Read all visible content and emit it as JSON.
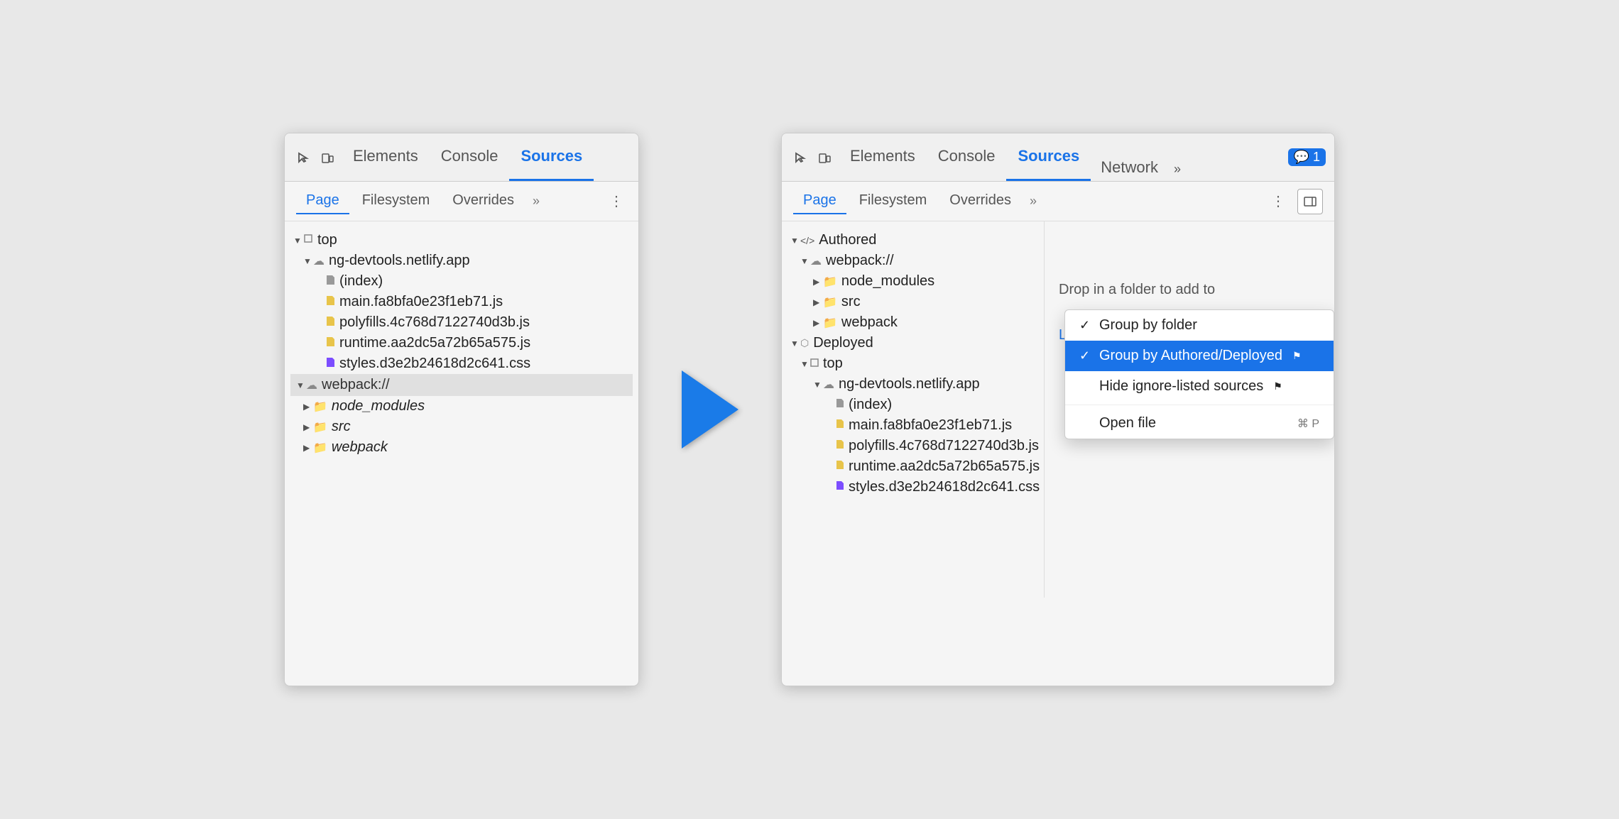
{
  "left_panel": {
    "toolbar": {
      "tabs": [
        "Elements",
        "Console",
        "Sources"
      ],
      "active_tab": "Sources"
    },
    "sub_tabs": {
      "items": [
        "Page",
        "Filesystem",
        "Overrides"
      ],
      "active": "Page"
    },
    "tree": [
      {
        "id": "top",
        "label": "top",
        "indent": 0,
        "type": "arrow_open",
        "icon": "square"
      },
      {
        "id": "ng-devtools",
        "label": "ng-devtools.netlify.app",
        "indent": 1,
        "type": "arrow_open",
        "icon": "cloud"
      },
      {
        "id": "index",
        "label": "(index)",
        "indent": 2,
        "type": "none",
        "icon": "html"
      },
      {
        "id": "main",
        "label": "main.fa8bfa0e23f1eb71.js",
        "indent": 2,
        "type": "none",
        "icon": "js"
      },
      {
        "id": "polyfills",
        "label": "polyfills.4c768d7122740d3b.js",
        "indent": 2,
        "type": "none",
        "icon": "js"
      },
      {
        "id": "runtime",
        "label": "runtime.aa2dc5a72b65a575.js",
        "indent": 2,
        "type": "none",
        "icon": "js"
      },
      {
        "id": "styles",
        "label": "styles.d3e2b24618d2c641.css",
        "indent": 2,
        "type": "none",
        "icon": "css"
      },
      {
        "id": "webpack",
        "label": "webpack://",
        "indent": 1,
        "type": "section",
        "icon": "cloud"
      },
      {
        "id": "node_modules",
        "label": "node_modules",
        "indent": 2,
        "type": "arrow_closed",
        "icon": "folder",
        "italic": true
      },
      {
        "id": "src",
        "label": "src",
        "indent": 2,
        "type": "arrow_closed",
        "icon": "folder",
        "italic": true
      },
      {
        "id": "webpack2",
        "label": "webpack",
        "indent": 2,
        "type": "arrow_closed",
        "icon": "folder",
        "italic": true
      }
    ]
  },
  "right_panel": {
    "toolbar": {
      "tabs": [
        "Elements",
        "Console",
        "Sources",
        "Network"
      ],
      "active_tab": "Sources",
      "more": ">>",
      "badge": "1"
    },
    "sub_tabs": {
      "items": [
        "Page",
        "Filesystem",
        "Overrides"
      ],
      "active": "Page"
    },
    "tree": [
      {
        "id": "authored",
        "label": "Authored",
        "indent": 0,
        "type": "arrow_open",
        "icon": "code"
      },
      {
        "id": "webpack-authored",
        "label": "webpack://",
        "indent": 1,
        "type": "arrow_open",
        "icon": "cloud"
      },
      {
        "id": "node_modules2",
        "label": "node_modules",
        "indent": 2,
        "type": "arrow_closed",
        "icon": "folder"
      },
      {
        "id": "src2",
        "label": "src",
        "indent": 2,
        "type": "arrow_closed",
        "icon": "folder"
      },
      {
        "id": "webpack3",
        "label": "webpack",
        "indent": 2,
        "type": "arrow_closed",
        "icon": "folder"
      },
      {
        "id": "deployed",
        "label": "Deployed",
        "indent": 0,
        "type": "arrow_open",
        "icon": "cube"
      },
      {
        "id": "top2",
        "label": "top",
        "indent": 1,
        "type": "arrow_open",
        "icon": "square"
      },
      {
        "id": "ng-devtools2",
        "label": "ng-devtools.netlify.app",
        "indent": 2,
        "type": "arrow_open",
        "icon": "cloud"
      },
      {
        "id": "index2",
        "label": "(index)",
        "indent": 3,
        "type": "none",
        "icon": "html"
      },
      {
        "id": "main2",
        "label": "main.fa8bfa0e23f1eb71.js",
        "indent": 3,
        "type": "none",
        "icon": "js"
      },
      {
        "id": "polyfills2",
        "label": "polyfills.4c768d7122740d3b.js",
        "indent": 3,
        "type": "none",
        "icon": "js"
      },
      {
        "id": "runtime2",
        "label": "runtime.aa2dc5a72b65a575.js",
        "indent": 3,
        "type": "none",
        "icon": "js"
      },
      {
        "id": "styles2",
        "label": "styles.d3e2b24618d2c641.css",
        "indent": 3,
        "type": "none",
        "icon": "css"
      }
    ],
    "filesystem": {
      "drop_text": "Drop in a folder to add to",
      "learn_more_text": "Learn more about Wor"
    }
  },
  "dropdown": {
    "items": [
      {
        "id": "group-by-folder",
        "label": "Group by folder",
        "checked": true,
        "selected": false,
        "shortcut": ""
      },
      {
        "id": "group-by-authored",
        "label": "Group by Authored/Deployed",
        "checked": true,
        "selected": true,
        "shortcut": "",
        "warning": true
      },
      {
        "id": "hide-ignore",
        "label": "Hide ignore-listed sources",
        "checked": false,
        "selected": false,
        "shortcut": "",
        "warning": true
      },
      {
        "id": "open-file",
        "label": "Open file",
        "checked": false,
        "selected": false,
        "shortcut": "⌘ P"
      }
    ]
  }
}
